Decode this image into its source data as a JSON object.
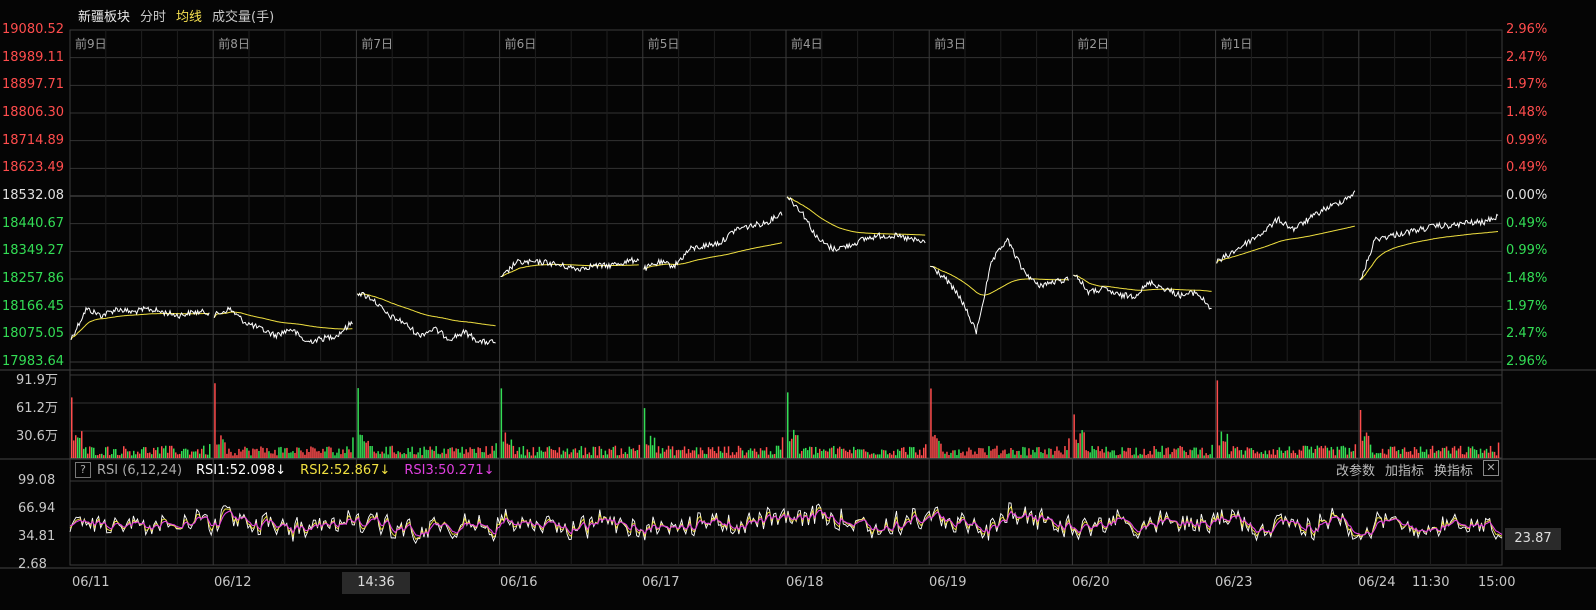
{
  "header": {
    "title": "新疆板块",
    "tab_fenshi": "分时",
    "tab_junxian": "均线",
    "tab_volume": "成交量(手)"
  },
  "price_axis_left": [
    "19080.52",
    "18989.11",
    "18897.71",
    "18806.30",
    "18714.89",
    "18623.49",
    "18532.08",
    "18440.67",
    "18349.27",
    "18257.86",
    "18166.45",
    "18075.05",
    "17983.64"
  ],
  "price_axis_right": [
    "2.96%",
    "2.47%",
    "1.97%",
    "1.48%",
    "0.99%",
    "0.49%",
    "0.00%",
    "0.49%",
    "0.99%",
    "1.48%",
    "1.97%",
    "2.47%",
    "2.96%"
  ],
  "day_labels": [
    "前9日",
    "前8日",
    "前7日",
    "前6日",
    "前5日",
    "前4日",
    "前3日",
    "前2日",
    "前1日"
  ],
  "volume_axis": [
    "91.9万",
    "61.2万",
    "30.6万"
  ],
  "rsi": {
    "help": "?",
    "name": "RSI (6,12,24)",
    "rsi1": "RSI1:52.098↓",
    "rsi2": "RSI2:52.867↓",
    "rsi3": "RSI3:50.271↓",
    "btn_params": "改参数",
    "btn_add": "加指标",
    "btn_switch": "换指标",
    "btn_close": "✕",
    "axis": [
      "99.08",
      "66.94",
      "34.81",
      "2.68"
    ],
    "current": "23.87"
  },
  "date_axis": [
    "06/11",
    "06/12",
    "06/16",
    "06/17",
    "06/18",
    "06/19",
    "06/20",
    "06/23",
    "06/24",
    "11:30",
    "15:00"
  ],
  "cursor_time": "14:36",
  "colors": {
    "up": "#ff4d4d",
    "down": "#33dd55",
    "price_line": "#ffffff",
    "avg_line": "#f0e040",
    "rsi1": "#ffffff",
    "rsi2": "#f0e040",
    "rsi3": "#e040e0",
    "grid": "#333333"
  }
}
